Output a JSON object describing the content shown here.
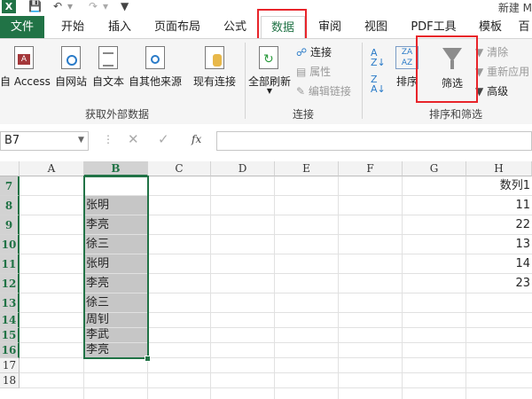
{
  "titlebar": {
    "app_icon": "X",
    "title": "新建 M",
    "qat": [
      "save-icon",
      "undo-icon",
      "redo-icon"
    ]
  },
  "tabs": [
    {
      "label": "文件"
    },
    {
      "label": "开始"
    },
    {
      "label": "插入"
    },
    {
      "label": "页面布局"
    },
    {
      "label": "公式"
    },
    {
      "label": "数据"
    },
    {
      "label": "审阅"
    },
    {
      "label": "视图"
    },
    {
      "label": "PDF工具"
    },
    {
      "label": "模板"
    },
    {
      "label": "百"
    }
  ],
  "ribbon": {
    "external": {
      "buttons": [
        "自 Access",
        "自网站",
        "自文本",
        "自其他来源",
        "现有连接"
      ],
      "label": "获取外部数据"
    },
    "connections": {
      "refresh_all": "全部刷新",
      "items": [
        "连接",
        "属性",
        "编辑链接"
      ],
      "label": "连接"
    },
    "sort_filter": {
      "sort": "排序",
      "filter": "筛选",
      "items": [
        "清除",
        "重新应用",
        "高级"
      ],
      "label": "排序和筛选"
    }
  },
  "formula_bar": {
    "name_box": "B7",
    "fx": "fx",
    "value": ""
  },
  "sheet": {
    "columns": [
      "A",
      "B",
      "C",
      "D",
      "E",
      "F",
      "G",
      "H"
    ],
    "rows": [
      "7",
      "8",
      "9",
      "10",
      "11",
      "12",
      "13",
      "14",
      "15",
      "16",
      "17",
      "18"
    ],
    "b_values": [
      "张明",
      "李亮",
      "徐三",
      "张明",
      "李亮",
      "徐三",
      "周钊",
      "李武",
      "李亮"
    ],
    "h_values": [
      "数列1",
      "11",
      "22",
      "13",
      "14",
      "23"
    ]
  },
  "colors": {
    "accent": "#217346",
    "highlight": "#e8242a",
    "selection_fill": "#c6c6c6"
  }
}
